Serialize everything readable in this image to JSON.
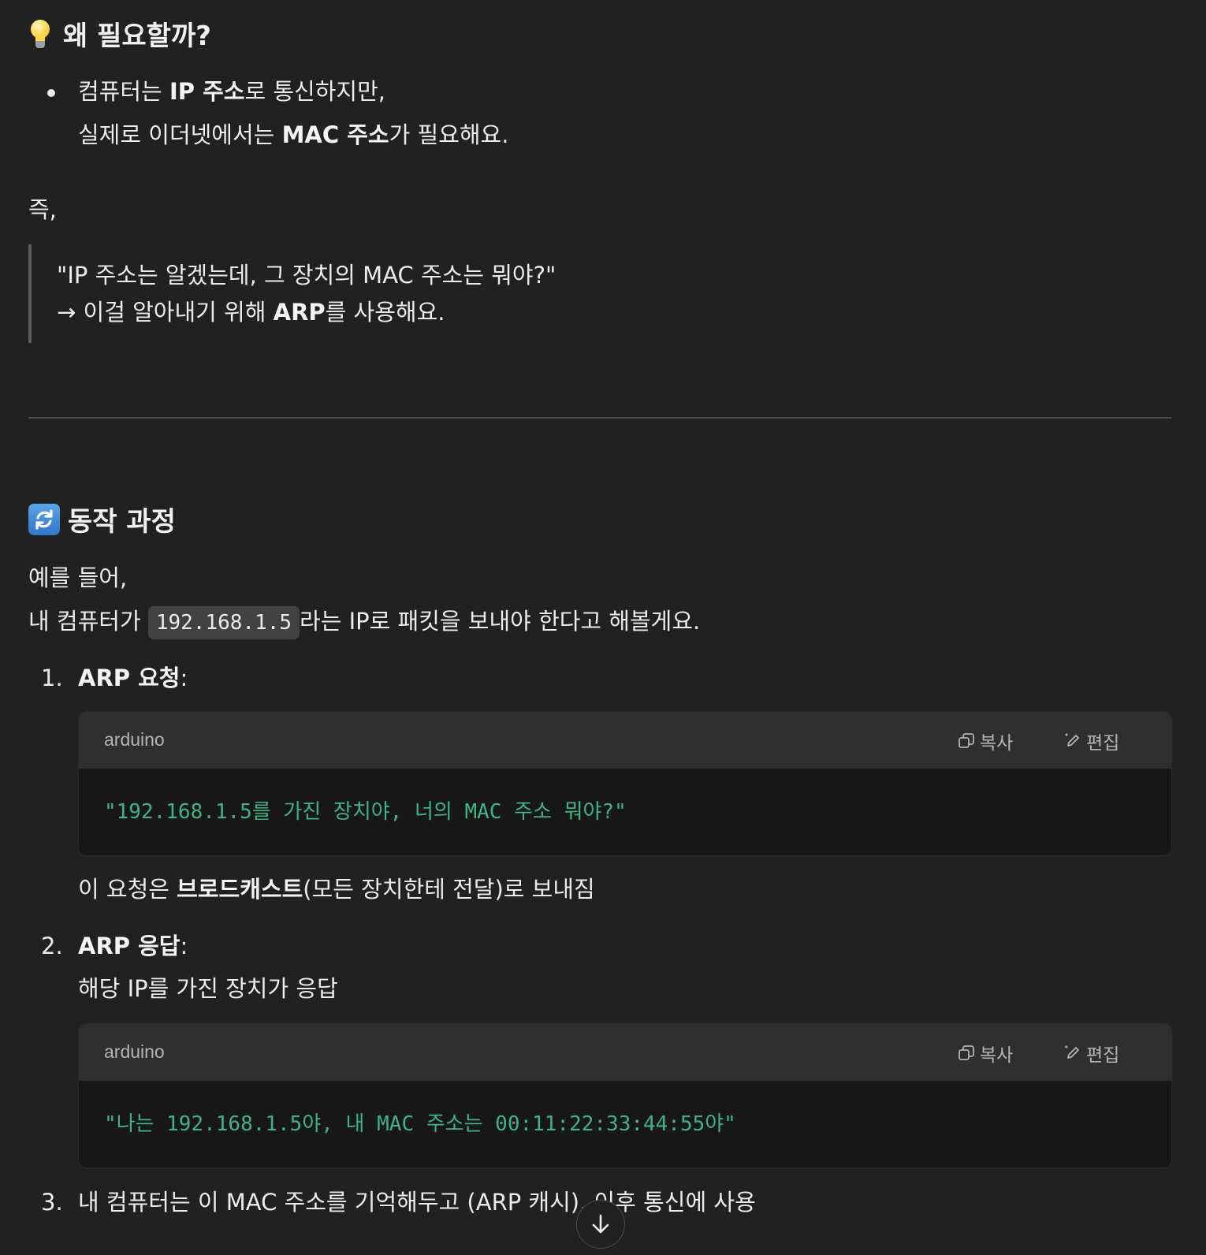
{
  "section_why": {
    "icon": "lightbulb-icon",
    "title": "왜 필요할까?",
    "bullet": {
      "line1_pre": "컴퓨터는 ",
      "line1_bold": "IP 주소",
      "line1_post": "로 통신하지만,",
      "line2_pre": "실제로 이더넷에서는 ",
      "line2_bold": "MAC 주소",
      "line2_post": "가 필요해요."
    },
    "that_is": "즉,",
    "quote": {
      "line1": "\"IP 주소는 알겠는데, 그 장치의 MAC 주소는 뭐야?\"",
      "line2_pre": "→ 이걸 알아내기 위해 ",
      "line2_bold": "ARP",
      "line2_post": "를 사용해요."
    }
  },
  "section_process": {
    "icon": "refresh-icon",
    "title": "동작 과정",
    "intro1": "예를 들어,",
    "intro2_pre": "내 컴퓨터가 ",
    "intro2_code": "192.168.1.5",
    "intro2_post": "라는 IP로 패킷을 보내야 한다고 해볼게요.",
    "steps": [
      {
        "number": "1.",
        "title_bold": "ARP 요청",
        "title_post": ":",
        "code": {
          "lang": "arduino",
          "copy_label": "복사",
          "edit_label": "편집",
          "text": "\"192.168.1.5를 가진 장치야, 너의 MAC 주소 뭐야?\""
        },
        "after_pre": "이 요청은 ",
        "after_bold": "브로드캐스트",
        "after_post": "(모든 장치한테 전달)로 보내짐"
      },
      {
        "number": "2.",
        "title_bold": "ARP 응답",
        "title_post": ":",
        "desc": "해당 IP를 가진 장치가 응답",
        "code": {
          "lang": "arduino",
          "copy_label": "복사",
          "edit_label": "편집",
          "text": "\"나는 192.168.1.5야, 내 MAC 주소는 00:11:22:33:44:55야\""
        }
      },
      {
        "number": "3.",
        "text": "내 컴퓨터는 이 MAC 주소를 기억해두고 (ARP 캐시), 이후 통신에 사용"
      }
    ]
  },
  "scroll_button_icon": "arrow-down-icon"
}
